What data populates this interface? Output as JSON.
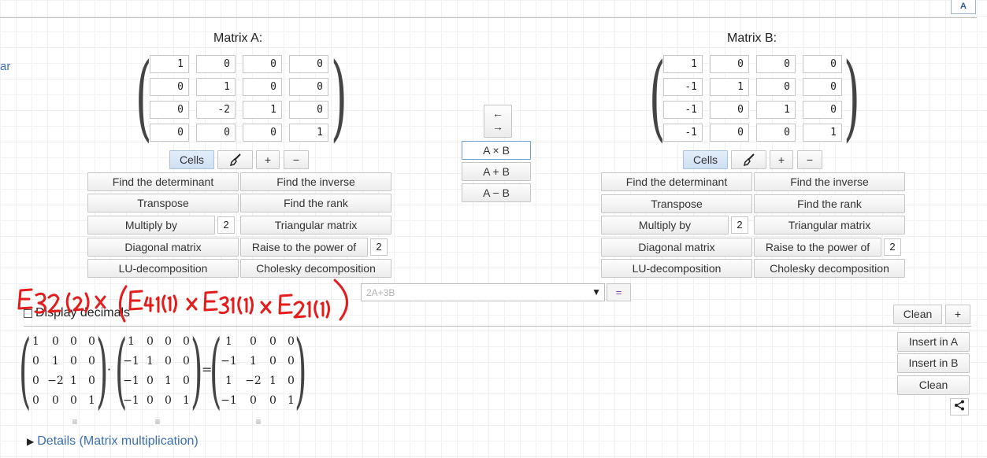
{
  "header": {
    "translate_icon_text": "A",
    "left_link_partial": "ar"
  },
  "matrixA": {
    "title": "Matrix A:",
    "cells": [
      [
        "1",
        "0",
        "0",
        "0"
      ],
      [
        "0",
        "1",
        "0",
        "0"
      ],
      [
        "0",
        "-2",
        "1",
        "0"
      ],
      [
        "0",
        "0",
        "0",
        "1"
      ]
    ],
    "toolbar": {
      "cells_label": "Cells",
      "plus_label": "+",
      "minus_label": "−"
    },
    "actions": {
      "determinant": "Find the determinant",
      "inverse": "Find the inverse",
      "transpose": "Transpose",
      "rank": "Find the rank",
      "multiply": "Multiply by",
      "multiply_value": "2",
      "triangular": "Triangular matrix",
      "diagonal": "Diagonal matrix",
      "power": "Raise to the power of",
      "power_value": "2",
      "lu": "LU-decomposition",
      "cholesky": "Cholesky decomposition"
    }
  },
  "matrixB": {
    "title": "Matrix B:",
    "cells": [
      [
        "1",
        "0",
        "0",
        "0"
      ],
      [
        "-1",
        "1",
        "0",
        "0"
      ],
      [
        "-1",
        "0",
        "1",
        "0"
      ],
      [
        "-1",
        "0",
        "0",
        "1"
      ]
    ],
    "toolbar": {
      "cells_label": "Cells",
      "plus_label": "+",
      "minus_label": "−"
    },
    "actions": {
      "determinant": "Find the determinant",
      "inverse": "Find the inverse",
      "transpose": "Transpose",
      "rank": "Find the rank",
      "multiply": "Multiply by",
      "multiply_value": "2",
      "triangular": "Triangular matrix",
      "diagonal": "Diagonal matrix",
      "power": "Raise to the power of",
      "power_value": "2",
      "lu": "LU-decomposition",
      "cholesky": "Cholesky decomposition"
    }
  },
  "middle": {
    "swap_left": "←",
    "swap_right": "→",
    "multiply": "A × B",
    "add": "A + B",
    "subtract": "A − B"
  },
  "expression": {
    "placeholder": "2A+3B",
    "equals_label": "="
  },
  "display_decimals_label": "Display decimals",
  "right_panel": {
    "clean_label": "Clean",
    "plus_label": "+",
    "insert_a": "Insert in A",
    "insert_b": "Insert in B",
    "clean2": "Clean"
  },
  "result": {
    "A": [
      [
        "1",
        "0",
        "0",
        "0"
      ],
      [
        "0",
        "1",
        "0",
        "0"
      ],
      [
        "0",
        "−2",
        "1",
        "0"
      ],
      [
        "0",
        "0",
        "0",
        "1"
      ]
    ],
    "B": [
      [
        "1",
        "0",
        "0",
        "0"
      ],
      [
        "−1",
        "1",
        "0",
        "0"
      ],
      [
        "−1",
        "0",
        "1",
        "0"
      ],
      [
        "−1",
        "0",
        "0",
        "1"
      ]
    ],
    "C": [
      [
        "1",
        "0",
        "0",
        "0"
      ],
      [
        "−1",
        "1",
        "0",
        "0"
      ],
      [
        "1",
        "−2",
        "1",
        "0"
      ],
      [
        "−1",
        "0",
        "0",
        "1"
      ]
    ],
    "dot_op": "·",
    "equals_op": "=",
    "menu_glyph": "≡"
  },
  "details_label": "Details (Matrix multiplication)",
  "annotation": {
    "handwritten_text": "E32 (2) × (E41(1) × E31(1) × E21(1))",
    "color": "#e02020"
  }
}
